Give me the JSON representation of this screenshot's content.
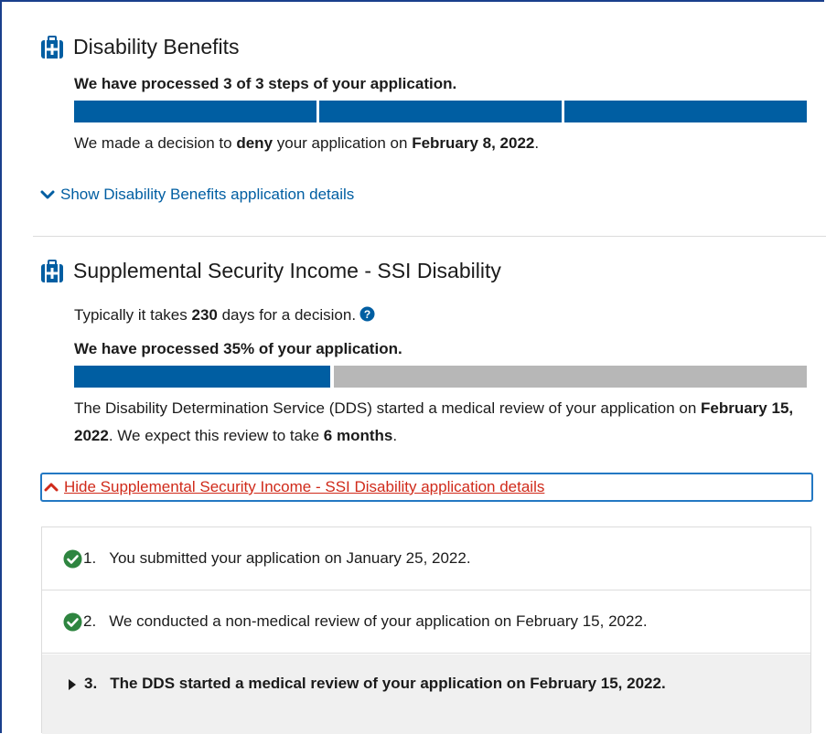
{
  "disability": {
    "title": "Disability Benefits",
    "progress_text": "We have processed 3 of 3 steps of your application.",
    "progress_steps_done": 3,
    "progress_steps_total": 3,
    "decision_prefix": "We made a decision to ",
    "decision_word": "deny",
    "decision_mid": " your application on ",
    "decision_date": "February 8, 2022",
    "decision_suffix": ".",
    "show_details_link": "Show Disability Benefits application details"
  },
  "ssi": {
    "title": "Supplemental Security Income - SSI Disability",
    "typical_prefix": "Typically it takes ",
    "typical_days": "230",
    "typical_suffix": " days for a decision.",
    "progress_text": "We have processed 35% of your application.",
    "progress_percent": 35,
    "review_prefix": "The Disability Determination Service (DDS) started a medical review of your application on ",
    "review_date": "February 15, 2022",
    "review_mid": ". We expect this review to take ",
    "review_duration": "6 months",
    "review_suffix": ".",
    "hide_details_link": "Hide Supplemental Security Income - SSI Disability application details",
    "steps": [
      {
        "num": "1.",
        "text": "You submitted your application on January 25, 2022."
      },
      {
        "num": "2.",
        "text": "We conducted a non-medical review of your application on February 15, 2022."
      },
      {
        "num": "3.",
        "text": "The DDS started a medical review of your application on February 15, 2022."
      }
    ]
  },
  "colors": {
    "primary_blue": "#005ea2",
    "progress_gray": "#b7b7b7",
    "link_red": "#d02a1a",
    "check_green": "#2e8540"
  },
  "icons": [
    "medical-briefcase-icon",
    "chevron-down-icon",
    "chevron-up-icon",
    "question-circle-icon",
    "check-circle-icon",
    "triangle-right-icon"
  ]
}
